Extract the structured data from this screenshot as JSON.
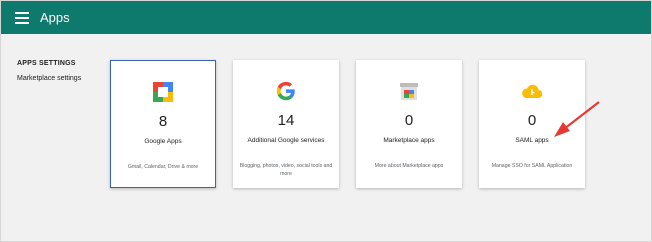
{
  "header": {
    "title": "Apps",
    "menu_icon": "menu-icon",
    "bg_color": "#0e7a6e"
  },
  "sidebar": {
    "heading": "APPS SETTINGS",
    "link": "Marketplace settings"
  },
  "cards": [
    {
      "icon": "google-workspace-icon",
      "count": "8",
      "title": "Google Apps",
      "description": "Gmail, Calendar, Drive & more",
      "selected": true
    },
    {
      "icon": "google-g-icon",
      "count": "14",
      "title": "Additional Google services",
      "description": "Blogging, photos, video, social tools and more"
    },
    {
      "icon": "marketplace-icon",
      "count": "0",
      "title": "Marketplace apps",
      "description": "More about Marketplace apps"
    },
    {
      "icon": "cloud-key-icon",
      "count": "0",
      "title": "SAML apps",
      "description": "Manage SSO for SAML Application"
    }
  ],
  "annotation": {
    "color": "#e53935",
    "target": "SAML apps"
  }
}
